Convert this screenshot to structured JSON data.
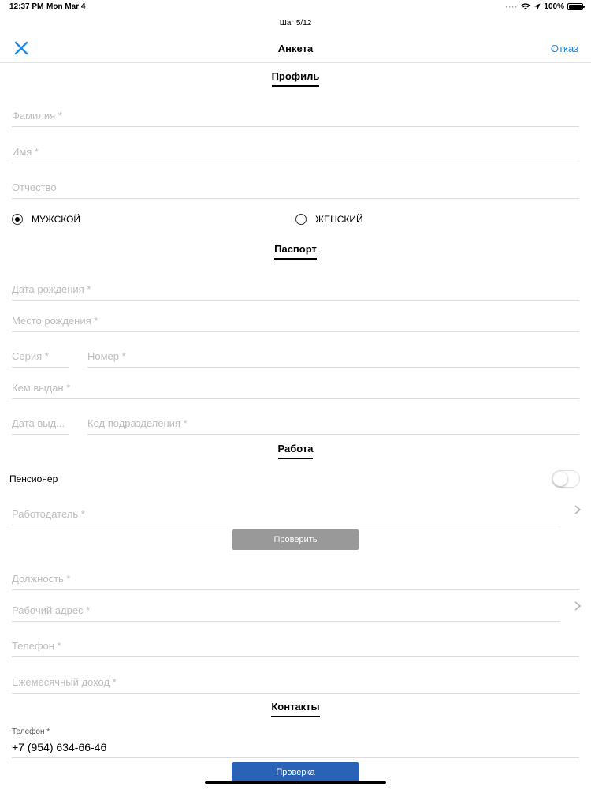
{
  "status_bar": {
    "time": "12:37 PM",
    "date": "Mon Mar 4",
    "battery": "100%"
  },
  "nav": {
    "step": "Шаг 5/12",
    "title": "Анкета",
    "cancel": "Отказ"
  },
  "profile": {
    "title": "Профиль",
    "last_name": "Фамилия *",
    "first_name": "Имя *",
    "middle_name": "Отчество",
    "gender_male": "МУЖСКОЙ",
    "gender_female": "ЖЕНСКИЙ"
  },
  "passport": {
    "title": "Паспорт",
    "birth_date": "Дата рождения *",
    "birth_place": "Место рождения *",
    "series": "Серия *",
    "number": "Номер *",
    "issued_by": "Кем выдан *",
    "issue_date": "Дата выд...",
    "division_code": "Код подразделения *"
  },
  "work": {
    "title": "Работа",
    "pensioner": "Пенсионер",
    "employer": "Работодатель *",
    "check_button": "Проверить",
    "position": "Должность *",
    "work_address": "Рабочий адрес *",
    "phone": "Телефон *",
    "income": "Ежемесячный доход *"
  },
  "contacts": {
    "title": "Контакты",
    "phone_label": "Телефон *",
    "phone_value": "+7 (954) 634-66-46",
    "verify_button": "Проверка"
  },
  "colors": {
    "accent": "#1e88e5",
    "button_gray": "#999999",
    "button_blue": "#2a62b8"
  }
}
